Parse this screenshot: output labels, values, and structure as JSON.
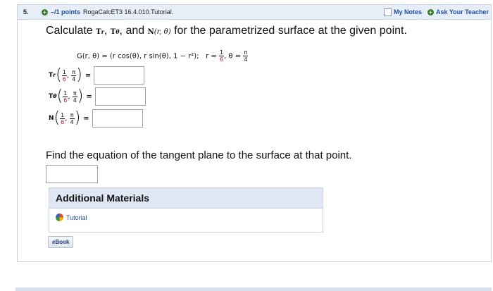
{
  "header": {
    "question_number": "5.",
    "points": "–/1 points",
    "source": "RogaCalcET3 16.4.010.Tutorial.",
    "my_notes": "My Notes",
    "ask_teacher": "Ask Your Teacher"
  },
  "prompt": {
    "pre": "Calculate",
    "tr": "T",
    "tr_sub": "r",
    "sep": ",",
    "ttheta": "T",
    "ttheta_sub": "θ",
    "and": "and",
    "n": "N",
    "n_args": "(r, θ)",
    "post": "for the parametrized surface at the given point."
  },
  "equation": {
    "lhs": "G(r, θ) = (r cos(θ), r sin(θ), 1 − r²);",
    "r_label": "r =",
    "r_num": "1",
    "r_den": "6",
    "theta_label": ", θ =",
    "theta_num": "π",
    "theta_den": "4"
  },
  "answers": [
    {
      "label": "T",
      "sub": "r",
      "a_num": "1",
      "a_den": "6",
      "b_num": "π",
      "b_den": "4",
      "eq": "="
    },
    {
      "label": "T",
      "sub": "θ",
      "a_num": "1",
      "a_den": "6",
      "b_num": "π",
      "b_den": "4",
      "eq": "="
    },
    {
      "label": "N",
      "sub": "",
      "a_num": "1",
      "a_den": "6",
      "b_num": "π",
      "b_den": "4",
      "eq": "="
    }
  ],
  "comma": ",",
  "tangent": {
    "text": "Find the equation of the tangent plane to the surface at that point."
  },
  "additional": {
    "title": "Additional Materials",
    "tutorial": "Tutorial"
  },
  "ebook": "eBook",
  "colors": {
    "accent_blue": "#1f4fa0",
    "header_bg": "#e7eef8",
    "red_value": "#c8102e"
  }
}
